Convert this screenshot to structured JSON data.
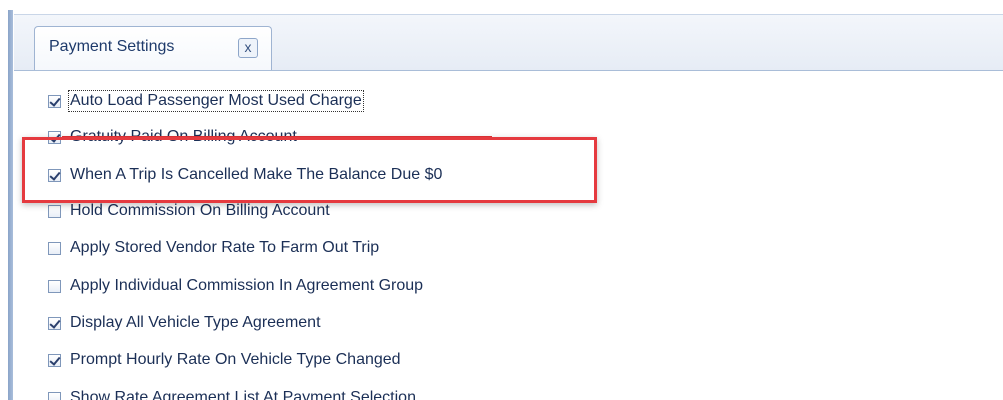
{
  "tab": {
    "label": "Payment Settings",
    "close_glyph": "x"
  },
  "options": [
    {
      "label": "Auto Load Passenger Most Used Charge",
      "checked": true
    },
    {
      "label": "Gratuity Paid On Billing Account",
      "checked": true
    },
    {
      "label": "When A Trip Is Cancelled Make The Balance Due $0",
      "checked": true
    },
    {
      "label": "Hold Commission On Billing Account",
      "checked": false
    },
    {
      "label": "Apply Stored Vendor Rate To Farm Out Trip",
      "checked": false
    },
    {
      "label": "Apply Individual Commission In Agreement Group",
      "checked": false
    },
    {
      "label": "Display All Vehicle Type Agreement",
      "checked": true
    },
    {
      "label": "Prompt Hourly Rate On Vehicle Type Changed",
      "checked": true
    },
    {
      "label": "Show Rate Agreement List At Payment Selection",
      "checked": false
    }
  ],
  "colors": {
    "highlight": "#e53a3f",
    "label_text": "#1b2f56"
  }
}
